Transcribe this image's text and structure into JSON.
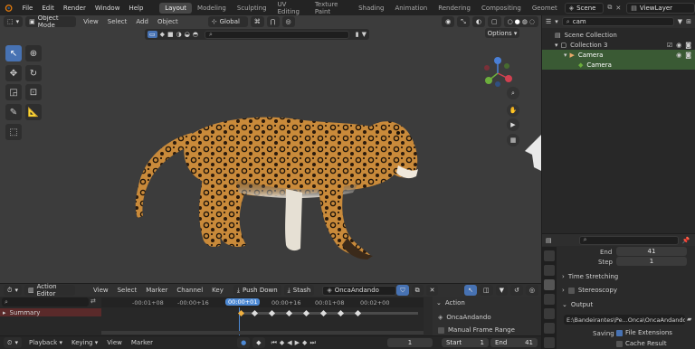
{
  "topbar": {
    "menus": [
      "File",
      "Edit",
      "Render",
      "Window",
      "Help"
    ],
    "workspaces": [
      "Layout",
      "Modeling",
      "Sculpting",
      "UV Editing",
      "Texture Paint",
      "Shading",
      "Animation",
      "Rendering",
      "Compositing",
      "Geomet"
    ],
    "active_workspace": "Layout",
    "scene": "Scene",
    "view_layer": "ViewLayer"
  },
  "viewport": {
    "mode": "Object Mode",
    "menus": [
      "View",
      "Select",
      "Add",
      "Object"
    ],
    "orientation": "Global",
    "options": "Options"
  },
  "outliner": {
    "search": "cam",
    "rows": [
      "Scene Collection",
      "Collection 3",
      "Camera",
      "Camera"
    ]
  },
  "properties": {
    "end_label": "End",
    "end_value": "41",
    "step_label": "Step",
    "step_value": "1",
    "time_stretching": "Time Stretching",
    "stereoscopy": "Stereoscopy",
    "output": "Output",
    "output_path": "E:\\Bandeirantes\\Pe...Onca\\OncaAndando",
    "saving_label": "Saving",
    "file_extensions": "File Extensions",
    "cache_result": "Cache Result"
  },
  "dopesheet": {
    "editor": "Action Editor",
    "menus": [
      "View",
      "Select",
      "Marker",
      "Channel",
      "Key"
    ],
    "push_down": "Push Down",
    "stash": "Stash",
    "action_name": "OncaAndando",
    "ticks": [
      "-00:01+08",
      "-00:00+16",
      "00:00+01",
      "00:00+16",
      "00:01+08",
      "00:02+00"
    ],
    "current": "00:00+01",
    "summary": "Summary",
    "panel_title": "Action",
    "panel_action": "OncaAndando",
    "manual_frame_range": "Manual Frame Range"
  },
  "timeline": {
    "menus": [
      "Playback",
      "Keying",
      "View",
      "Marker"
    ],
    "current_frame": "1",
    "start_label": "Start",
    "start_value": "1",
    "end_label": "End",
    "end_value": "41"
  },
  "colors": {
    "accent": "#4772b3",
    "playhead": "#4d89d4",
    "selection_green": "#3a5a34",
    "summary": "#5a2a2a"
  }
}
